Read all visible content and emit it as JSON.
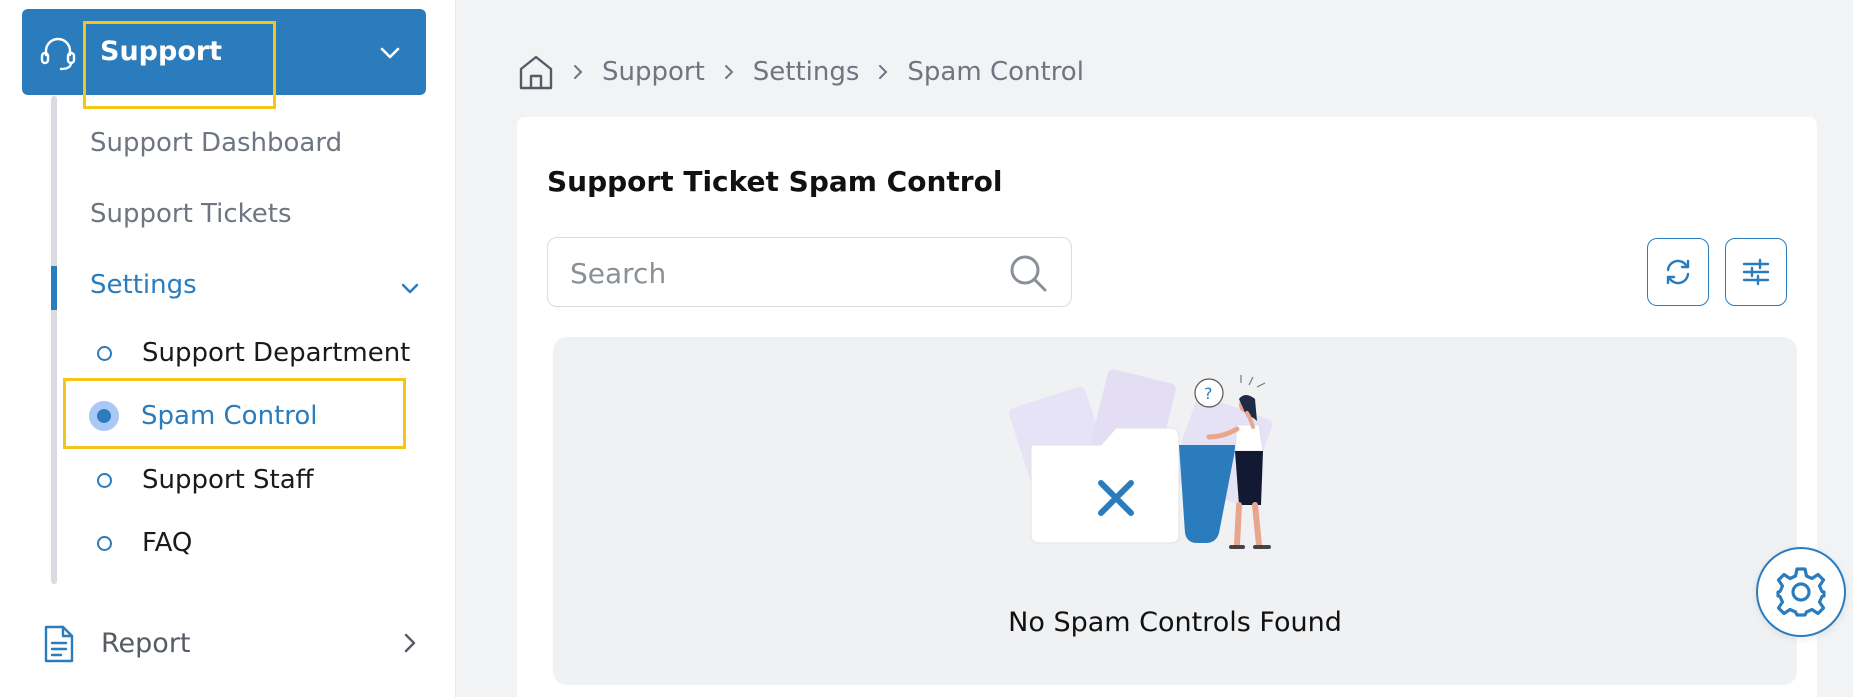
{
  "sidebar": {
    "header": {
      "label": "Support",
      "icon": "headset-icon",
      "color": "#2b7cbd"
    },
    "items": [
      {
        "label": "Support Dashboard"
      },
      {
        "label": "Support Tickets"
      }
    ],
    "settings": {
      "label": "Settings",
      "children": [
        {
          "label": "Support Department",
          "active": false
        },
        {
          "label": "Spam Control",
          "active": true
        },
        {
          "label": "Support Staff",
          "active": false
        },
        {
          "label": "FAQ",
          "active": false
        }
      ]
    },
    "report": {
      "label": "Report",
      "icon": "document-icon"
    }
  },
  "breadcrumb": {
    "home_icon": "home-icon",
    "items": [
      "Support",
      "Settings",
      "Spam Control"
    ]
  },
  "main": {
    "title": "Support Ticket Spam Control",
    "search": {
      "placeholder": "Search",
      "value": ""
    },
    "toolbar": {
      "refresh_icon": "refresh-icon",
      "filter_icon": "sliders-icon"
    },
    "empty_state": {
      "message": "No Spam Controls Found",
      "illustration": "empty-folder-illustration"
    }
  },
  "fab": {
    "icon": "gear-icon"
  },
  "colors": {
    "accent": "#2b7cbd",
    "highlight": "#f5c518",
    "active_dot_bg": "#a9c8f5"
  }
}
